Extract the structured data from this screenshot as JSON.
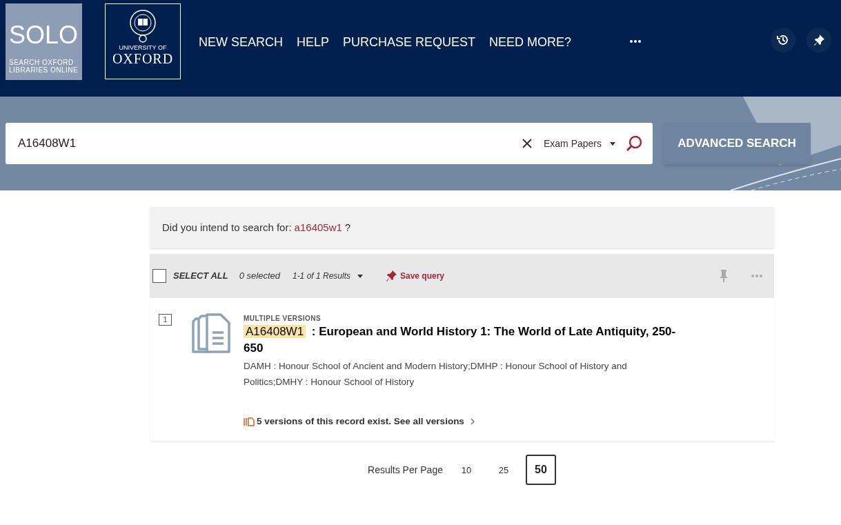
{
  "header": {
    "solo_logo": {
      "title": "SOLO",
      "subtitle": [
        "SEARCH OXFORD",
        "LIBRARIES ONLINE"
      ]
    },
    "oxford_logo": {
      "line_1": "UNIVERSITY OF",
      "line_2": "OXFORD"
    },
    "nav": [
      "NEW SEARCH",
      "HELP",
      "PURCHASE REQUEST",
      "NEED MORE?"
    ]
  },
  "search": {
    "value": "A16408W1",
    "scope": "Exam Papers",
    "advanced_button": "ADVANCED SEARCH"
  },
  "suggestion": {
    "prefix": "Did you intend to search for:",
    "link": "a16405w1",
    "suffix": "?"
  },
  "toolbar": {
    "select_all": {
      "label": "SELECT ALL",
      "checked": false
    },
    "selected_count": "0 selected",
    "range": "1-1 of 1 Results",
    "save_query": "Save query"
  },
  "results": [
    {
      "number": "1",
      "badge": "MULTIPLE VERSIONS",
      "highlight": "A16408W1",
      "title": ": European and World History 1: The World of Late Antiquity, 250-650",
      "description": "DAMH : Honour School of Ancient and Modern History;DMHP : Honour School of History and Politics;DMHY : Honour School of History",
      "versions_link": "5 versions of this record exist. See all versions"
    }
  ],
  "pagination": {
    "label": "Results Per Page",
    "options": [
      {
        "label": "10",
        "selected": false
      },
      {
        "label": "25",
        "selected": false
      },
      {
        "label": "50",
        "selected": true
      }
    ]
  }
}
